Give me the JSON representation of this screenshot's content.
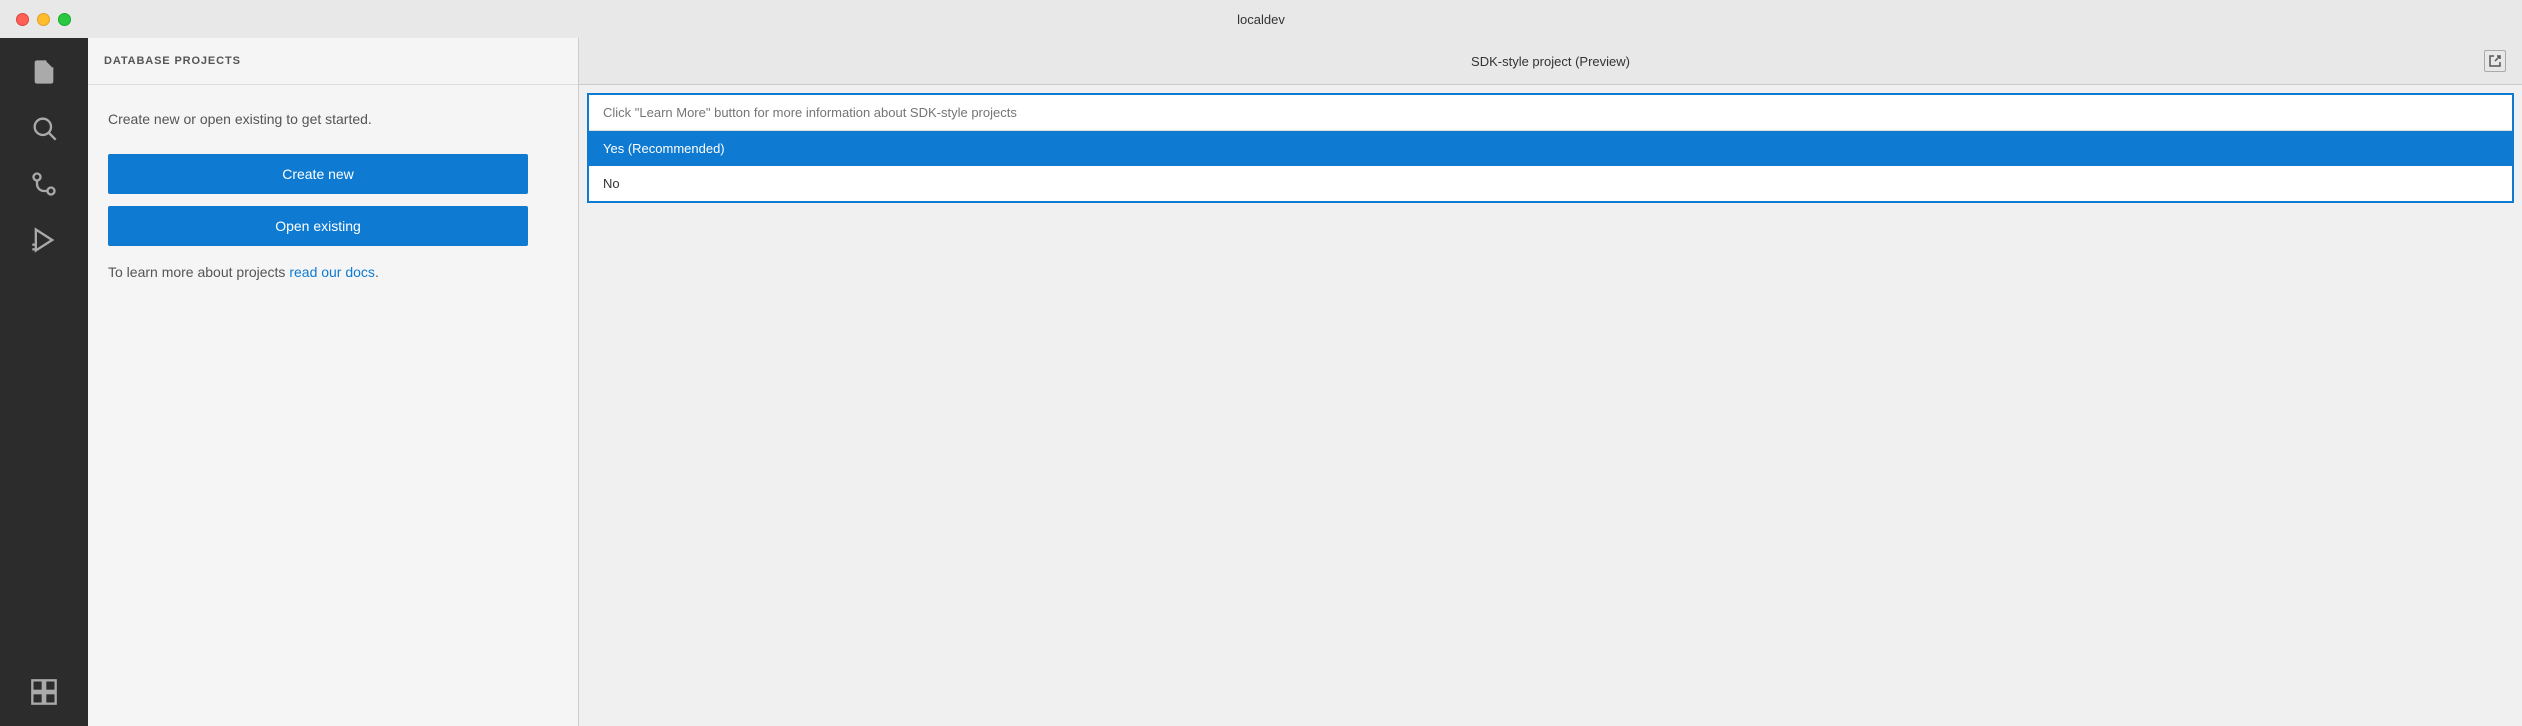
{
  "titlebar": {
    "title": "localdev"
  },
  "activity_bar": {
    "icons": [
      {
        "name": "files-icon",
        "label": "Explorer",
        "unicode": "⧉"
      },
      {
        "name": "search-icon",
        "label": "Search",
        "unicode": "⌕"
      },
      {
        "name": "source-control-icon",
        "label": "Source Control",
        "unicode": "⎇"
      },
      {
        "name": "run-debug-icon",
        "label": "Run and Debug",
        "unicode": "▷"
      },
      {
        "name": "extensions-icon",
        "label": "Extensions",
        "unicode": "⊞"
      }
    ]
  },
  "sidebar": {
    "header_title": "DATABASE PROJECTS",
    "description": "Create new or open existing to get started.",
    "create_new_label": "Create new",
    "open_existing_label": "Open existing",
    "docs_text_before": "To learn more about projects ",
    "docs_link_text": "read our docs",
    "docs_text_after": "."
  },
  "sdk_dialog": {
    "title": "SDK-style project (Preview)",
    "input_placeholder": "Click \"Learn More\" button for more information about SDK-style projects",
    "options": [
      {
        "label": "Yes (Recommended)",
        "selected": true
      },
      {
        "label": "No",
        "selected": false
      }
    ]
  }
}
